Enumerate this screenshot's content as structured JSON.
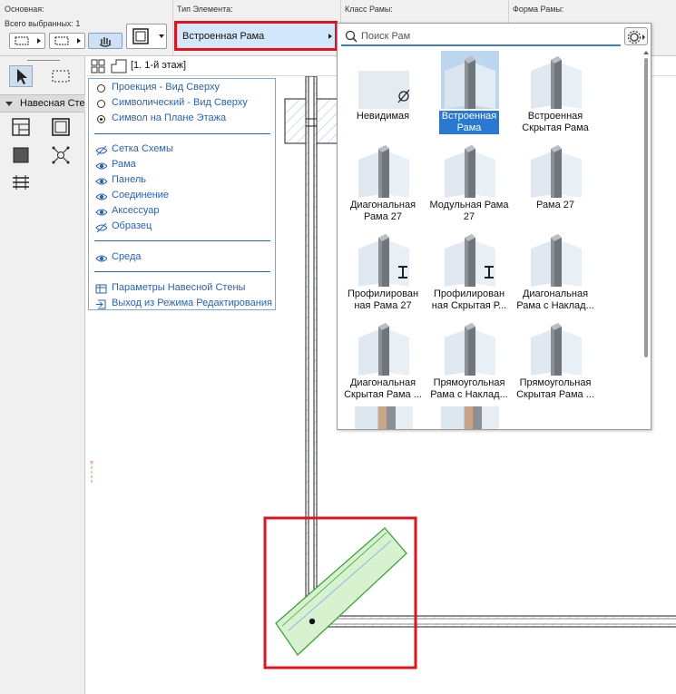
{
  "info_box": {
    "main_label": "Основная:",
    "selected_count": "Всего выбранных: 1",
    "element_type_label": "Тип Элемента:",
    "frame_class_label": "Класс Рамы:",
    "frame_shape_label": "Форма Рамы:",
    "frame_type_value": "Встроенная Рама"
  },
  "toolbox": {
    "group_title": "Навесная Стена"
  },
  "view": {
    "story_label": "[1. 1-й этаж]"
  },
  "edit_palette": {
    "radios": [
      {
        "label": "Проекция - Вид Сверху",
        "checked": false
      },
      {
        "label": "Символический - Вид Сверху",
        "checked": false
      },
      {
        "label": "Символ на Плане Этажа",
        "checked": true
      }
    ],
    "visibility": [
      {
        "label": "Сетка Схемы",
        "icon": "eye-hidden-icon"
      },
      {
        "label": "Рама",
        "icon": "eye-icon"
      },
      {
        "label": "Панель",
        "icon": "eye-icon"
      },
      {
        "label": "Соединение",
        "icon": "eye-icon"
      },
      {
        "label": "Аксессуар",
        "icon": "eye-icon"
      },
      {
        "label": "Образец",
        "icon": "eye-hidden-icon"
      }
    ],
    "environment": {
      "label": "Среда",
      "icon": "eye-icon"
    },
    "commands": [
      {
        "label": "Параметры Навесной Стены",
        "icon": "settings-table-icon"
      },
      {
        "label": "Выход из Режима Редактирования",
        "icon": "exit-edit-icon"
      }
    ]
  },
  "frame_popup": {
    "search_placeholder": "Поиск Рам",
    "items": [
      {
        "line1": "Невидимая",
        "line2": "",
        "icon": "invisible-frame-icon",
        "selected": false
      },
      {
        "line1": "Встроенная",
        "line2": "Рама",
        "icon": "built-in-frame-icon",
        "selected": true
      },
      {
        "line1": "Встроенная",
        "line2": "Скрытая Рама",
        "icon": "hidden-built-in-frame-icon",
        "selected": false
      },
      {
        "line1": "Диагональная",
        "line2": "Рама 27",
        "icon": "diagonal-frame-27-icon",
        "selected": false
      },
      {
        "line1": "Модульная Рама",
        "line2": "27",
        "icon": "modular-frame-27-icon",
        "selected": false
      },
      {
        "line1": "Рама 27",
        "line2": "",
        "icon": "frame-27-icon",
        "selected": false
      },
      {
        "line1": "Профилирован",
        "line2": "ная Рама 27",
        "icon": "profiled-frame-27-icon",
        "selected": false
      },
      {
        "line1": "Профилирован",
        "line2": "ная Скрытая Р...",
        "icon": "profiled-hidden-frame-icon",
        "selected": false
      },
      {
        "line1": "Диагональная",
        "line2": "Рама с Наклад...",
        "icon": "diagonal-cap-frame-icon",
        "selected": false
      },
      {
        "line1": "Диагональная",
        "line2": "Скрытая Рама ...",
        "icon": "diagonal-hidden-frame-icon",
        "selected": false
      },
      {
        "line1": "Прямоугольная",
        "line2": "Рама с Наклад...",
        "icon": "rectangular-cap-frame-icon",
        "selected": false
      },
      {
        "line1": "Прямоугольная",
        "line2": "Скрытая Рама ...",
        "icon": "rectangular-hidden-frame-icon",
        "selected": false
      }
    ]
  },
  "colors": {
    "highlight_red": "#e0141e",
    "selection_blue": "#2a78d0",
    "palette_text_blue": "#2a62b6",
    "selected_element_green": "#d8f2d0"
  }
}
